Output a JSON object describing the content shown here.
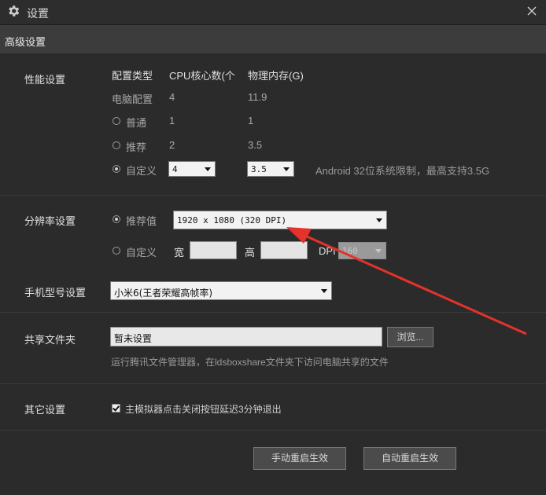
{
  "window": {
    "title": "设置",
    "icon": "gear-icon",
    "close_icon": "close-icon"
  },
  "tab": {
    "label": "高级设置"
  },
  "performance": {
    "section_label": "性能设置",
    "headers": {
      "type": "配置类型",
      "cpu": "CPU核心数(个",
      "memory": "物理内存(G)"
    },
    "pc_config": {
      "label": "电脑配置",
      "cpu": "4",
      "memory": "11.9"
    },
    "normal": {
      "label": "普通",
      "cpu": "1",
      "memory": "1",
      "selected": false
    },
    "recommended": {
      "label": "推荐",
      "cpu": "2",
      "memory": "3.5",
      "selected": false
    },
    "custom": {
      "label": "自定义",
      "cpu": "4",
      "memory": "3.5",
      "selected": true
    },
    "note": "Android 32位系统限制，最高支持3.5G"
  },
  "resolution": {
    "section_label": "分辨率设置",
    "recommended": {
      "label": "推荐值",
      "selected": true,
      "value": "1920 x 1080 (320 DPI)"
    },
    "custom": {
      "label": "自定义",
      "selected": false,
      "width_label": "宽",
      "height_label": "高",
      "dpi_label": "DPI",
      "dpi_value": "160"
    }
  },
  "phone_model": {
    "section_label": "手机型号设置",
    "value": "小米6(王者荣耀高帧率)"
  },
  "shared_folder": {
    "section_label": "共享文件夹",
    "value": "暂未设置",
    "browse_label": "浏览...",
    "hint": "运行腾讯文件管理器，在ldsboxshare文件夹下访问电脑共享的文件"
  },
  "other": {
    "section_label": "其它设置",
    "delay_exit_label": "主模拟器点击关闭按钮延迟3分钟退出",
    "delay_exit_checked": true
  },
  "actions": {
    "manual_restart": "手动重启生效",
    "auto_restart": "自动重启生效"
  },
  "annotation": {
    "arrow_color": "#e5322b"
  }
}
